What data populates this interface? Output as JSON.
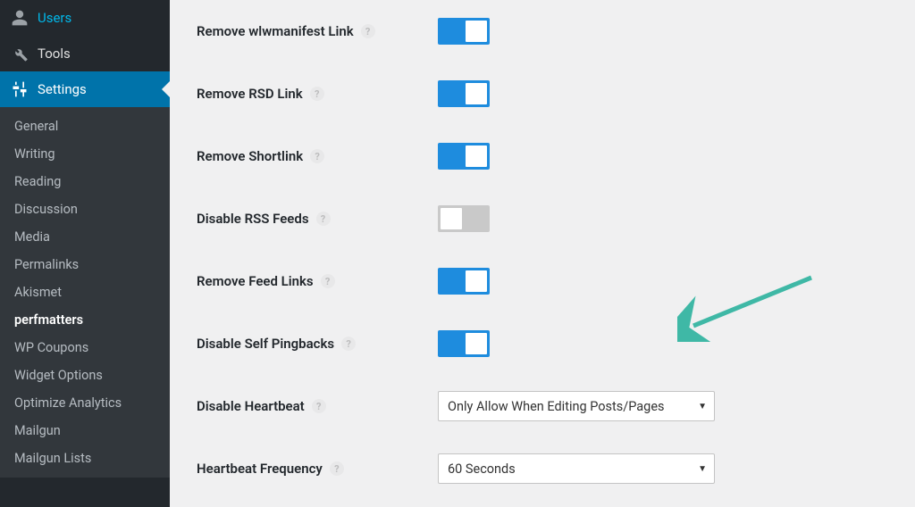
{
  "sidebar": {
    "top_items": [
      {
        "label": "Users",
        "icon": "users-icon"
      },
      {
        "label": "Tools",
        "icon": "tools-icon"
      },
      {
        "label": "Settings",
        "icon": "settings-icon"
      }
    ],
    "submenu": [
      "General",
      "Writing",
      "Reading",
      "Discussion",
      "Media",
      "Permalinks",
      "Akismet",
      "perfmatters",
      "WP Coupons",
      "Widget Options",
      "Optimize Analytics",
      "Mailgun",
      "Mailgun Lists"
    ],
    "submenu_current_index": 7
  },
  "rows": [
    {
      "label": "Remove wlwmanifest Link",
      "type": "toggle",
      "state": "on"
    },
    {
      "label": "Remove RSD Link",
      "type": "toggle",
      "state": "on"
    },
    {
      "label": "Remove Shortlink",
      "type": "toggle",
      "state": "on"
    },
    {
      "label": "Disable RSS Feeds",
      "type": "toggle",
      "state": "off"
    },
    {
      "label": "Remove Feed Links",
      "type": "toggle",
      "state": "on"
    },
    {
      "label": "Disable Self Pingbacks",
      "type": "toggle",
      "state": "on"
    },
    {
      "label": "Disable Heartbeat",
      "type": "select",
      "value": "Only Allow When Editing Posts/Pages"
    },
    {
      "label": "Heartbeat Frequency",
      "type": "select",
      "value": "60 Seconds"
    }
  ],
  "colors": {
    "accent": "#0073aa",
    "toggle_on": "#1e8cde",
    "toggle_off": "#c9c9c9",
    "arrow": "#3fb8a6"
  }
}
